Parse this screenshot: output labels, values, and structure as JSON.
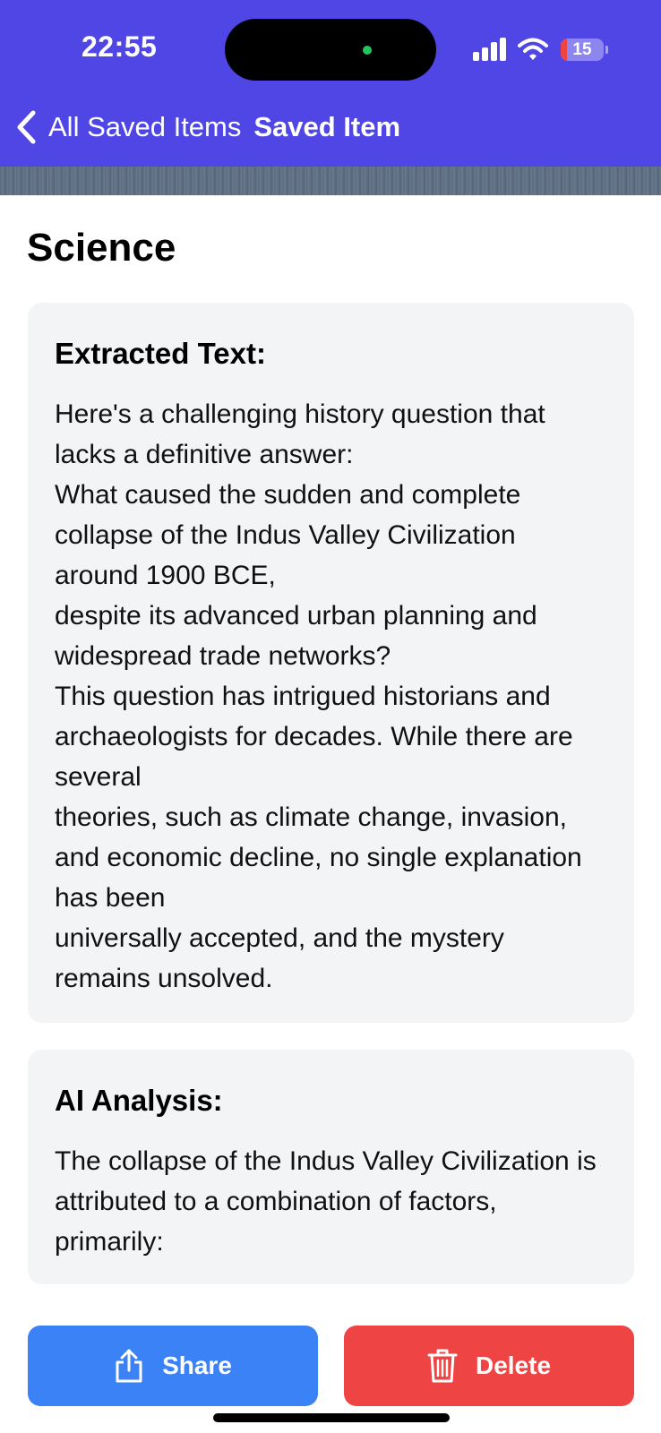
{
  "status_bar": {
    "time": "22:55",
    "battery": "15"
  },
  "nav": {
    "back_label": "All Saved Items",
    "title": "Saved Item"
  },
  "page": {
    "title": "Science"
  },
  "extracted": {
    "heading": "Extracted Text:",
    "lines": [
      "Here's a challenging history question that",
      "lacks a definitive answer:",
      "What caused the sudden and complete",
      "collapse of the Indus Valley Civilization",
      "around 1900 BCE,",
      "despite its advanced urban planning and",
      "widespread trade networks?",
      "This question has intrigued historians and",
      "archaeologists for decades. While there are",
      "several",
      "theories, such as climate change, invasion,",
      "and economic decline, no single explanation",
      "has been",
      "universally accepted, and the mystery",
      "remains unsolved."
    ]
  },
  "analysis": {
    "heading": "AI Analysis:",
    "lines": [
      "The collapse of the Indus Valley Civilization is",
      "attributed to a combination of factors,",
      "primarily:"
    ]
  },
  "actions": {
    "share_label": "Share",
    "delete_label": "Delete"
  },
  "colors": {
    "header_bg": "#4f46e5",
    "share": "#3b82f6",
    "delete": "#ef4444",
    "card_bg": "#f3f4f6"
  },
  "icons": [
    "chevron-left-icon",
    "signal-icon",
    "wifi-icon",
    "battery-icon",
    "share-icon",
    "trash-icon"
  ]
}
